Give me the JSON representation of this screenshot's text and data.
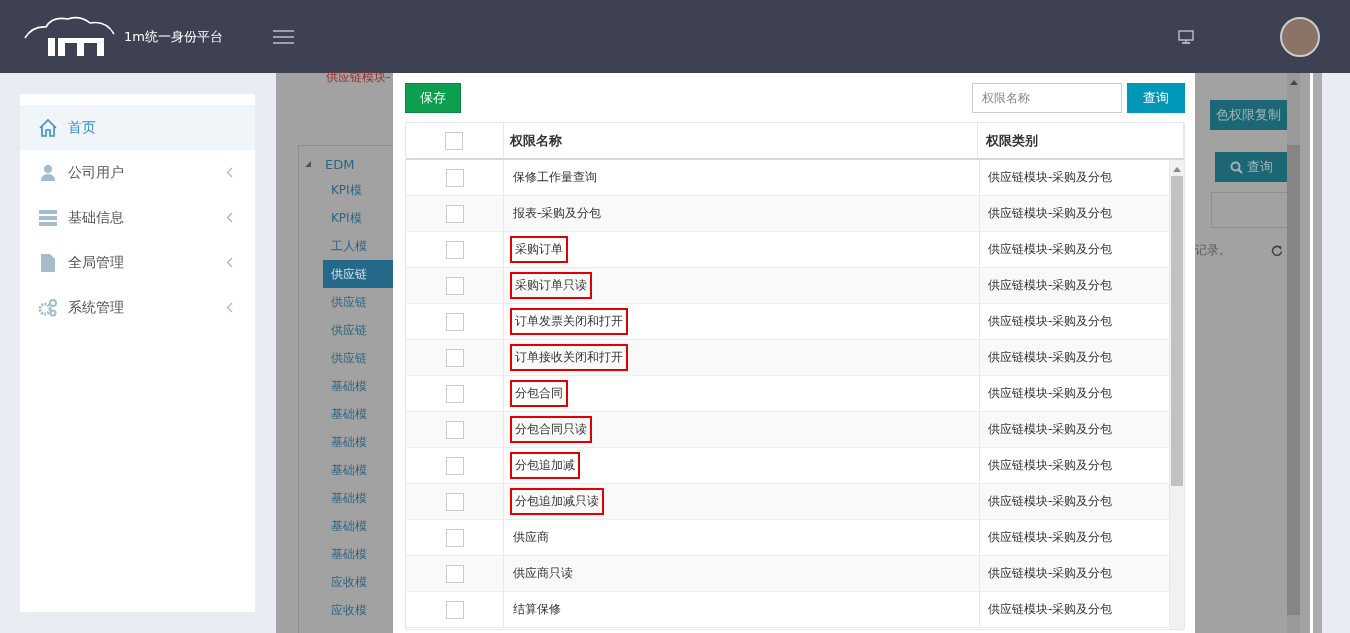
{
  "header": {
    "title": "1m统一身份平台"
  },
  "sidebar": {
    "items": [
      {
        "label": "首页",
        "selected": true,
        "has_submenu": false
      },
      {
        "label": "公司用户",
        "selected": false,
        "has_submenu": true
      },
      {
        "label": "基础信息",
        "selected": false,
        "has_submenu": true
      },
      {
        "label": "全局管理",
        "selected": false,
        "has_submenu": true
      },
      {
        "label": "系统管理",
        "selected": false,
        "has_submenu": true
      }
    ]
  },
  "background_page": {
    "notice": "供应链模块-",
    "tree": {
      "label": "EDM",
      "expanded": true,
      "children": [
        {
          "label": "KPI模",
          "selected": false
        },
        {
          "label": "KPI模",
          "selected": false
        },
        {
          "label": "工人模",
          "selected": false
        },
        {
          "label": "供应链",
          "selected": true
        },
        {
          "label": "供应链",
          "selected": false
        },
        {
          "label": "供应链",
          "selected": false
        },
        {
          "label": "供应链",
          "selected": false
        },
        {
          "label": "基础模",
          "selected": false
        },
        {
          "label": "基础模",
          "selected": false
        },
        {
          "label": "基础模",
          "selected": false
        },
        {
          "label": "基础模",
          "selected": false
        },
        {
          "label": "基础模",
          "selected": false
        },
        {
          "label": "基础模",
          "selected": false
        },
        {
          "label": "基础模",
          "selected": false
        },
        {
          "label": "应收模",
          "selected": false
        },
        {
          "label": "应收模",
          "selected": false
        }
      ]
    },
    "copy_button": "色权限复制",
    "search_button": "查询",
    "status_text": "记录。"
  },
  "modal": {
    "save_button": "保存",
    "search": {
      "placeholder": "权限名称"
    },
    "search_button": "查询",
    "table": {
      "columns": [
        "权限名称",
        "权限类别"
      ],
      "header_checked": false,
      "rows": [
        {
          "name": "保修工作量查询",
          "category": "供应链模块-采购及分包",
          "checked": false,
          "highlighted": false
        },
        {
          "name": "报表-采购及分包",
          "category": "供应链模块-采购及分包",
          "checked": false,
          "highlighted": false
        },
        {
          "name": "采购订单",
          "category": "供应链模块-采购及分包",
          "checked": false,
          "highlighted": true
        },
        {
          "name": "采购订单只读",
          "category": "供应链模块-采购及分包",
          "checked": false,
          "highlighted": true
        },
        {
          "name": "订单发票关闭和打开",
          "category": "供应链模块-采购及分包",
          "checked": false,
          "highlighted": true
        },
        {
          "name": "订单接收关闭和打开",
          "category": "供应链模块-采购及分包",
          "checked": false,
          "highlighted": true
        },
        {
          "name": "分包合同",
          "category": "供应链模块-采购及分包",
          "checked": false,
          "highlighted": true
        },
        {
          "name": "分包合同只读",
          "category": "供应链模块-采购及分包",
          "checked": false,
          "highlighted": true
        },
        {
          "name": "分包追加减",
          "category": "供应链模块-采购及分包",
          "checked": false,
          "highlighted": true
        },
        {
          "name": "分包追加减只读",
          "category": "供应链模块-采购及分包",
          "checked": false,
          "highlighted": true
        },
        {
          "name": "供应商",
          "category": "供应链模块-采购及分包",
          "checked": false,
          "highlighted": false
        },
        {
          "name": "供应商只读",
          "category": "供应链模块-采购及分包",
          "checked": false,
          "highlighted": false
        },
        {
          "name": "结算保修",
          "category": "供应链模块-采购及分包",
          "checked": false,
          "highlighted": false
        }
      ]
    }
  }
}
